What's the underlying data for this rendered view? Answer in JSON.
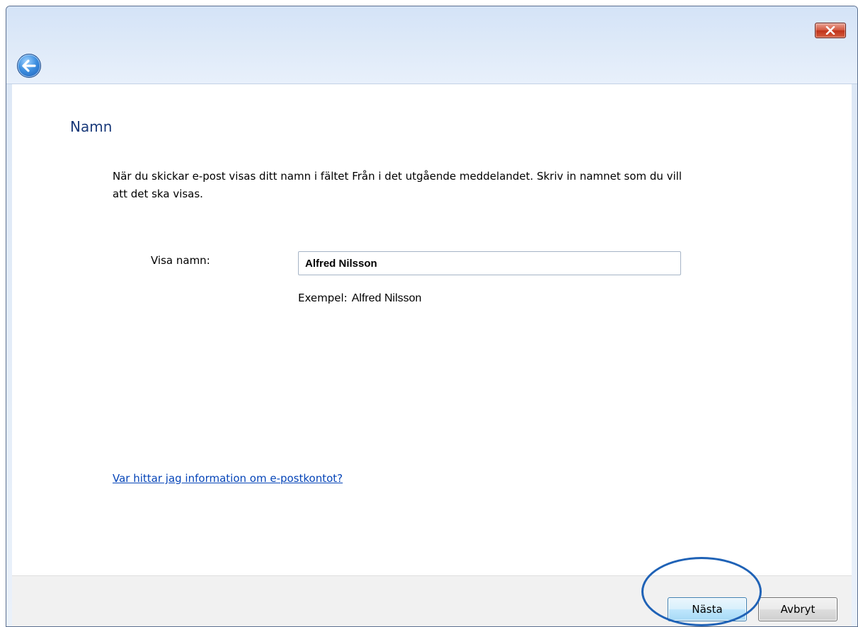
{
  "window": {
    "close_icon": "close-icon",
    "back_icon": "back-arrow-icon"
  },
  "page": {
    "title": "Namn",
    "description": "När du skickar e-post visas ditt namn i fältet Från i det utgående meddelandet. Skriv in namnet som du vill att det ska visas.",
    "display_name_label": "Visa namn:",
    "display_name_value": "Alfred Nilsson",
    "example_label": "Exempel:",
    "example_value": "Alfred Nilsson",
    "help_link": "Var hittar jag information om e-postkontot?"
  },
  "footer": {
    "next_label": "Nästa",
    "cancel_label": "Avbryt"
  },
  "colors": {
    "title": "#1a3a7a",
    "link": "#0645b8",
    "highlight": "#1f62b6"
  }
}
